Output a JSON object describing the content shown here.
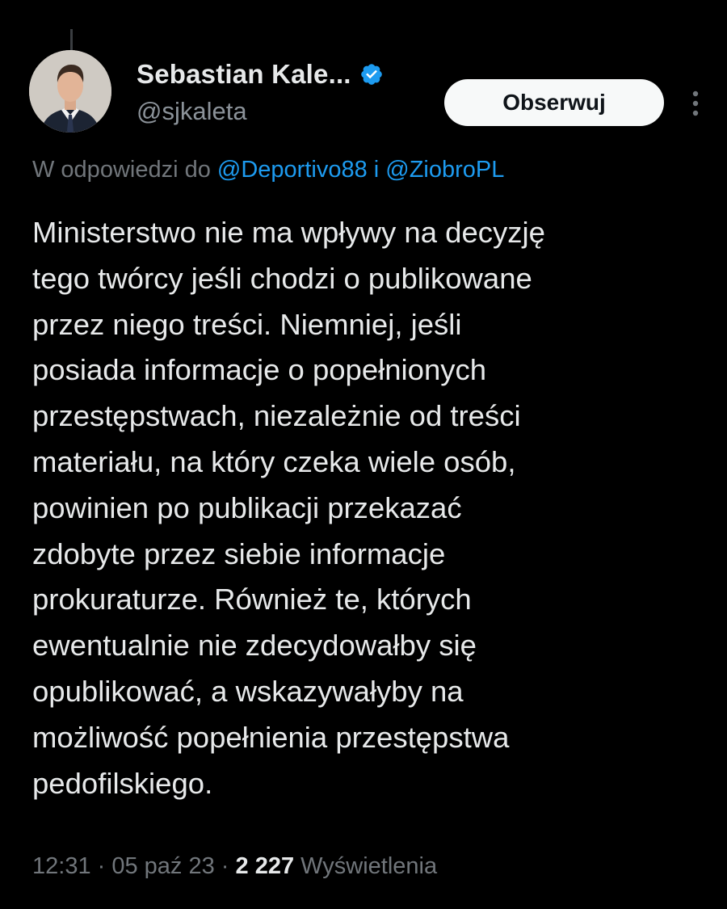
{
  "author": {
    "display_name": "Sebastian Kale...",
    "handle": "@sjkaleta",
    "verified": true
  },
  "actions": {
    "follow_label": "Obserwuj"
  },
  "reply_context": {
    "prefix": "W odpowiedzi do ",
    "mention_1": "@Deportivo88",
    "joiner": " i ",
    "mention_2": "@ZiobroPL"
  },
  "tweet": {
    "text": "Ministerstwo nie ma wpływy na decyzję\ntego twórcy jeśli chodzi o publikowane\nprzez niego treści. Niemniej, jeśli\nposiada informacje o popełnionych\nprzestępstwach, niezależnie od treści\nmateriału, na który czeka wiele osób,\npowinien po publikacji przekazać\nzdobyte przez siebie informacje\nprokuraturze. Również te, których\newentualnie nie zdecydowałby się\nopublikować, a wskazywałyby na\nmożliwość popełnienia przestępstwa\npedofilskiego."
  },
  "meta": {
    "time": "12:31",
    "separator_1": " · ",
    "date": "05 paź 23",
    "separator_2": " · ",
    "views_count": "2 227",
    "views_label": " Wyświetlenia"
  },
  "icons": {
    "verified": "verified-badge-icon",
    "more": "more-options-icon",
    "avatar": "profile-photo"
  },
  "colors": {
    "background": "#000000",
    "text": "#e7e9ea",
    "secondary": "#71767b",
    "link": "#1d9bf0",
    "follow_bg": "#f7f9f9"
  }
}
